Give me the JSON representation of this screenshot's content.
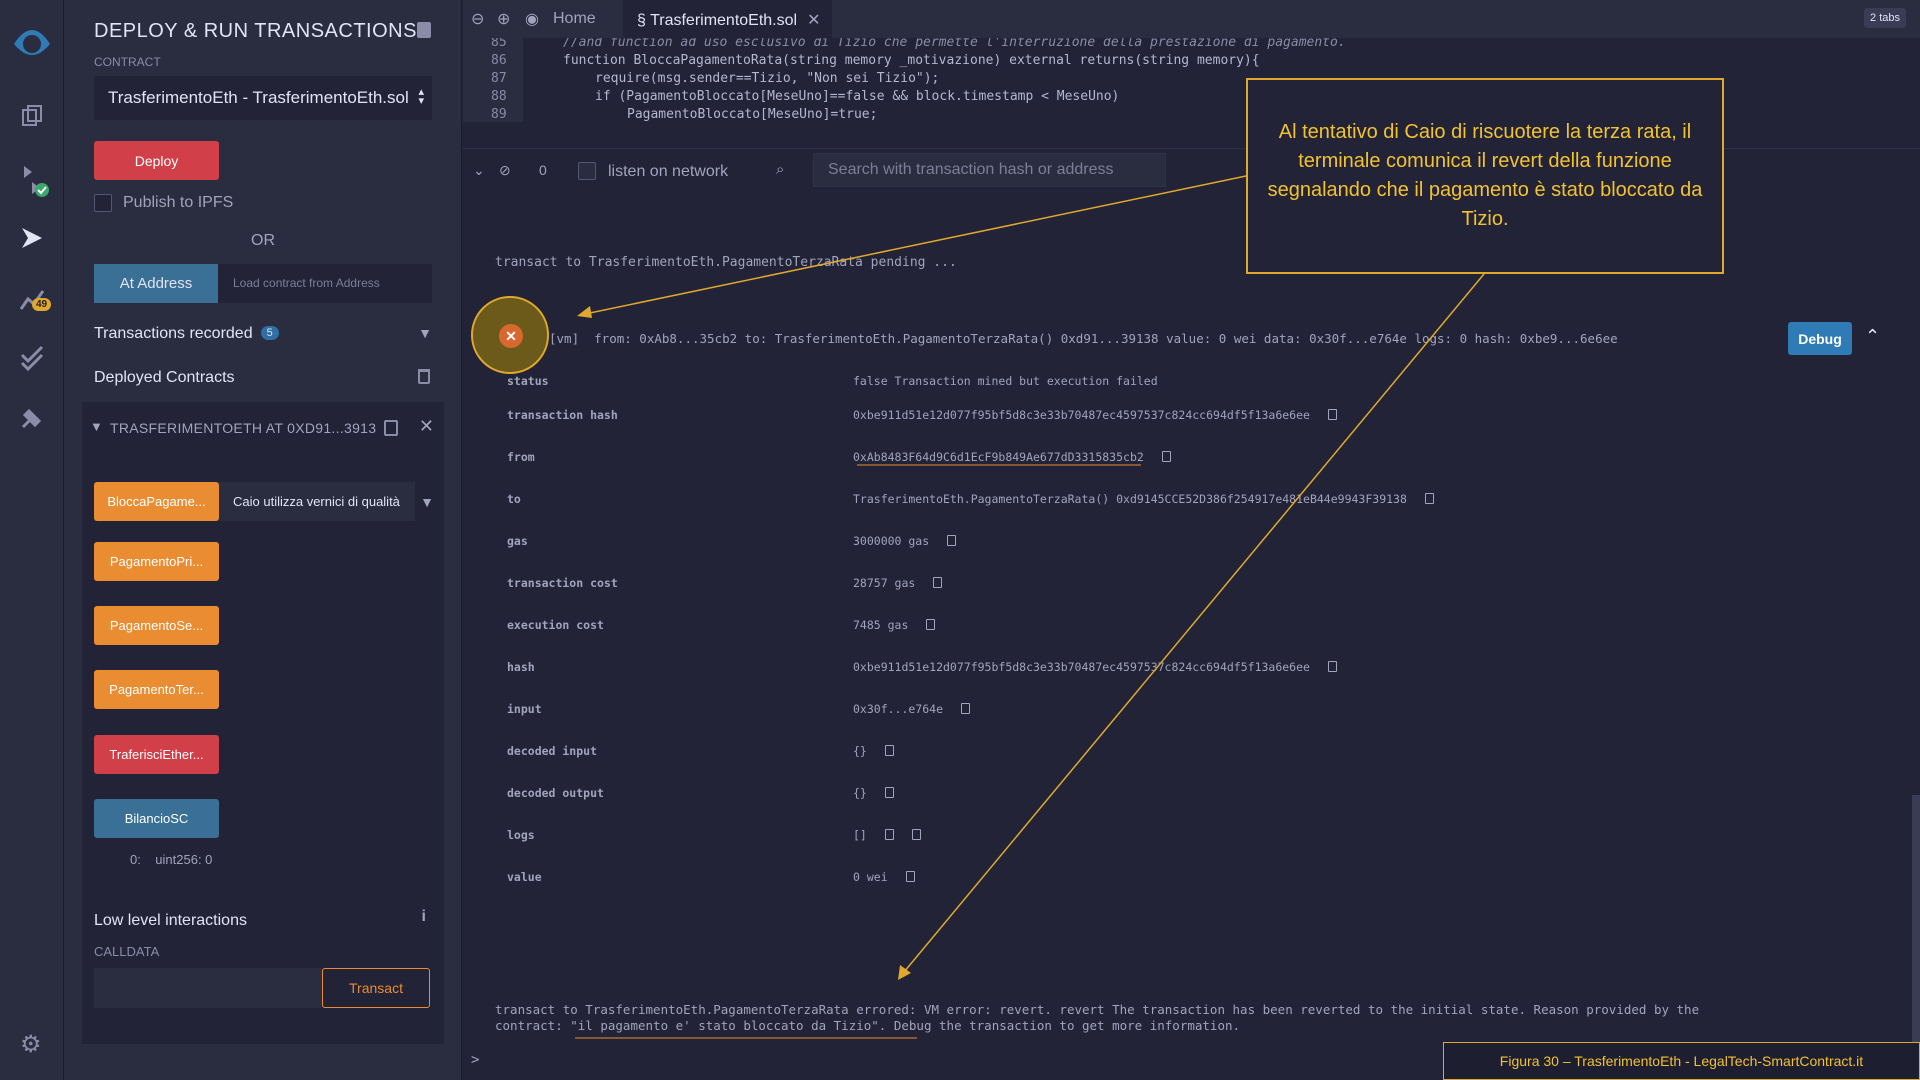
{
  "rail": {
    "icons": [
      "remix-logo-icon",
      "file-explorer-icon",
      "solidity-compiler-icon",
      "deploy-run-icon",
      "analytics-icon",
      "unit-test-icon",
      "plugin-manager-icon"
    ],
    "analytics_badge": "49",
    "settings_icon": "gear-icon"
  },
  "panel": {
    "title": "DEPLOY & RUN TRANSACTIONS",
    "contract_label": "CONTRACT",
    "contract_selected": "TrasferimentoEth - TrasferimentoEth.sol",
    "deploy_label": "Deploy",
    "publish_label": "Publish to IPFS",
    "or_label": "OR",
    "at_address_label": "At Address",
    "load_placeholder": "Load contract from Address",
    "transactions_recorded_label": "Transactions recorded",
    "transactions_recorded_count": "5",
    "deployed_contracts_label": "Deployed Contracts",
    "instance_title": "TRASFERIMENTOETH AT 0XD91...3913",
    "functions": [
      {
        "label": "BloccaPagame...",
        "color": "orange"
      },
      {
        "label": "PagamentoPri...",
        "color": "orange"
      },
      {
        "label": "PagamentoSe...",
        "color": "orange"
      },
      {
        "label": "PagamentoTer...",
        "color": "orange"
      },
      {
        "label": "TraferisciEther...",
        "color": "red"
      },
      {
        "label": "BilancioSC",
        "color": "blue"
      }
    ],
    "blocca_input_value": "Caio utilizza vernici di qualità",
    "bilancio_result_index": "0:",
    "bilancio_result_value": "uint256: 0",
    "low_level_label": "Low level interactions",
    "calldata_label": "CALLDATA",
    "transact_label": "Transact"
  },
  "tabs": {
    "home_label": "Home",
    "file_label": "TrasferimentoEth.sol",
    "tabs_count": "2 tabs"
  },
  "editor": {
    "lines": [
      {
        "num": "85",
        "text": "//and function ad uso esclusivo di Tizio che permette l'interruzione della prestazione di pagamento."
      },
      {
        "num": "86",
        "text": "function BloccaPagamentoRata(string memory _motivazione) external returns(string memory){"
      },
      {
        "num": "87",
        "text": "require(msg.sender==Tizio, \"Non sei Tizio\");"
      },
      {
        "num": "88",
        "text": "if (PagamentoBloccato[MeseUno]==false && block.timestamp < MeseUno)"
      },
      {
        "num": "89",
        "text": "PagamentoBloccato[MeseUno]=true;"
      }
    ]
  },
  "terminal": {
    "pending_count": "0",
    "listen_label": "listen on network",
    "search_placeholder": "Search with transaction hash or address",
    "pending_line": "transact to TrasferimentoEth.PagamentoTerzaRata pending ...",
    "tx_summary": "[vm]  from: 0xAb8...35cb2 to: TrasferimentoEth.PagamentoTerzaRata() 0xd91...39138 value: 0 wei data: 0x30f...e764e logs: 0 hash: 0xbe9...6e6ee",
    "debug_label": "Debug",
    "details": [
      {
        "key": "status",
        "value": "false Transaction mined but execution failed",
        "copy": false
      },
      {
        "key": "transaction hash",
        "value": "0xbe911d51e12d077f95bf5d8c3e33b70487ec4597537c824cc694df5f13a6e6ee",
        "copy": true
      },
      {
        "key": "from",
        "value": "0xAb8483F64d9C6d1EcF9b849Ae677dD3315835cb2",
        "copy": true
      },
      {
        "key": "to",
        "value": "TrasferimentoEth.PagamentoTerzaRata() 0xd9145CCE52D386f254917e481eB44e9943F39138",
        "copy": true
      },
      {
        "key": "gas",
        "value": "3000000 gas",
        "copy": true
      },
      {
        "key": "transaction cost",
        "value": "28757 gas",
        "copy": true
      },
      {
        "key": "execution cost",
        "value": "7485 gas",
        "copy": true
      },
      {
        "key": "hash",
        "value": "0xbe911d51e12d077f95bf5d8c3e33b70487ec4597537c824cc694df5f13a6e6ee",
        "copy": true
      },
      {
        "key": "input",
        "value": "0x30f...e764e",
        "copy": true
      },
      {
        "key": "decoded input",
        "value": "{}",
        "copy": true
      },
      {
        "key": "decoded output",
        "value": "{}",
        "copy": true
      },
      {
        "key": "logs",
        "value": "[]",
        "copy": true
      },
      {
        "key": "value",
        "value": "0 wei",
        "copy": true
      }
    ],
    "error_line_1": "transact to TrasferimentoEth.PagamentoTerzaRata errored: VM error: revert. revert The transaction has been reverted to the initial state. Reason provided by the",
    "error_line_2": "contract: \"il pagamento e' stato bloccato da Tizio\". Debug the transaction to get more information.",
    "prompt": ">"
  },
  "annotation": {
    "callout_text": "Al tentativo di Caio di riscuotere la terza rata, il terminale comunica il revert della funzione segnalando che il pagamento è stato bloccato da Tizio.",
    "caption": "Figura 30 – TrasferimentoEth - LegalTech-SmartContract.it",
    "accent_color": "#e0a82e"
  }
}
